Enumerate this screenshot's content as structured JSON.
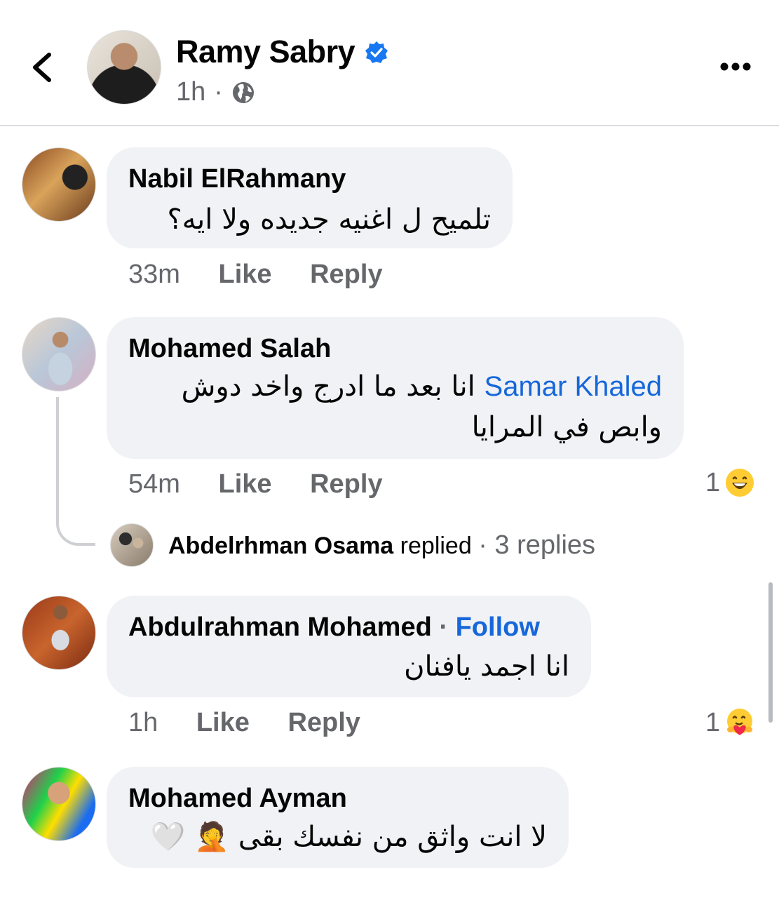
{
  "post": {
    "author": "Ramy Sabry",
    "time": "1h",
    "separator": "·"
  },
  "comments": [
    {
      "author": "Nabil ElRahmany",
      "text": "تلميح ل اغنيه جديده ولا ايه؟",
      "time": "33m",
      "like": "Like",
      "reply": "Reply"
    },
    {
      "author": "Mohamed Salah",
      "mention": "Samar Khaled",
      "text_line1": "انا بعد ما ادرج واخد دوش",
      "text_line2": "وابص في المرايا",
      "time": "54m",
      "like": "Like",
      "reply": "Reply",
      "reaction_count": "1",
      "reaction_icon": "laughing-emoji"
    },
    {
      "author": "Abdulrahman Mohamed",
      "follow": "Follow",
      "text": "انا اجمد يافنان",
      "time": "1h",
      "like": "Like",
      "reply": "Reply",
      "reaction_count": "1",
      "reaction_icon": "care-emoji"
    },
    {
      "author": "Mohamed Ayman",
      "text": "لا انت واثق من نفسك بقى 🤦 🤍",
      "time": "",
      "like": "",
      "reply": ""
    }
  ],
  "reply_summary": {
    "author": "Abdelrhman Osama",
    "verb": "replied",
    "count": "· 3 replies"
  },
  "colors": {
    "link": "#1667d9",
    "verified": "#1877f2",
    "bubble": "#f0f2f5",
    "meta": "#65676b"
  }
}
